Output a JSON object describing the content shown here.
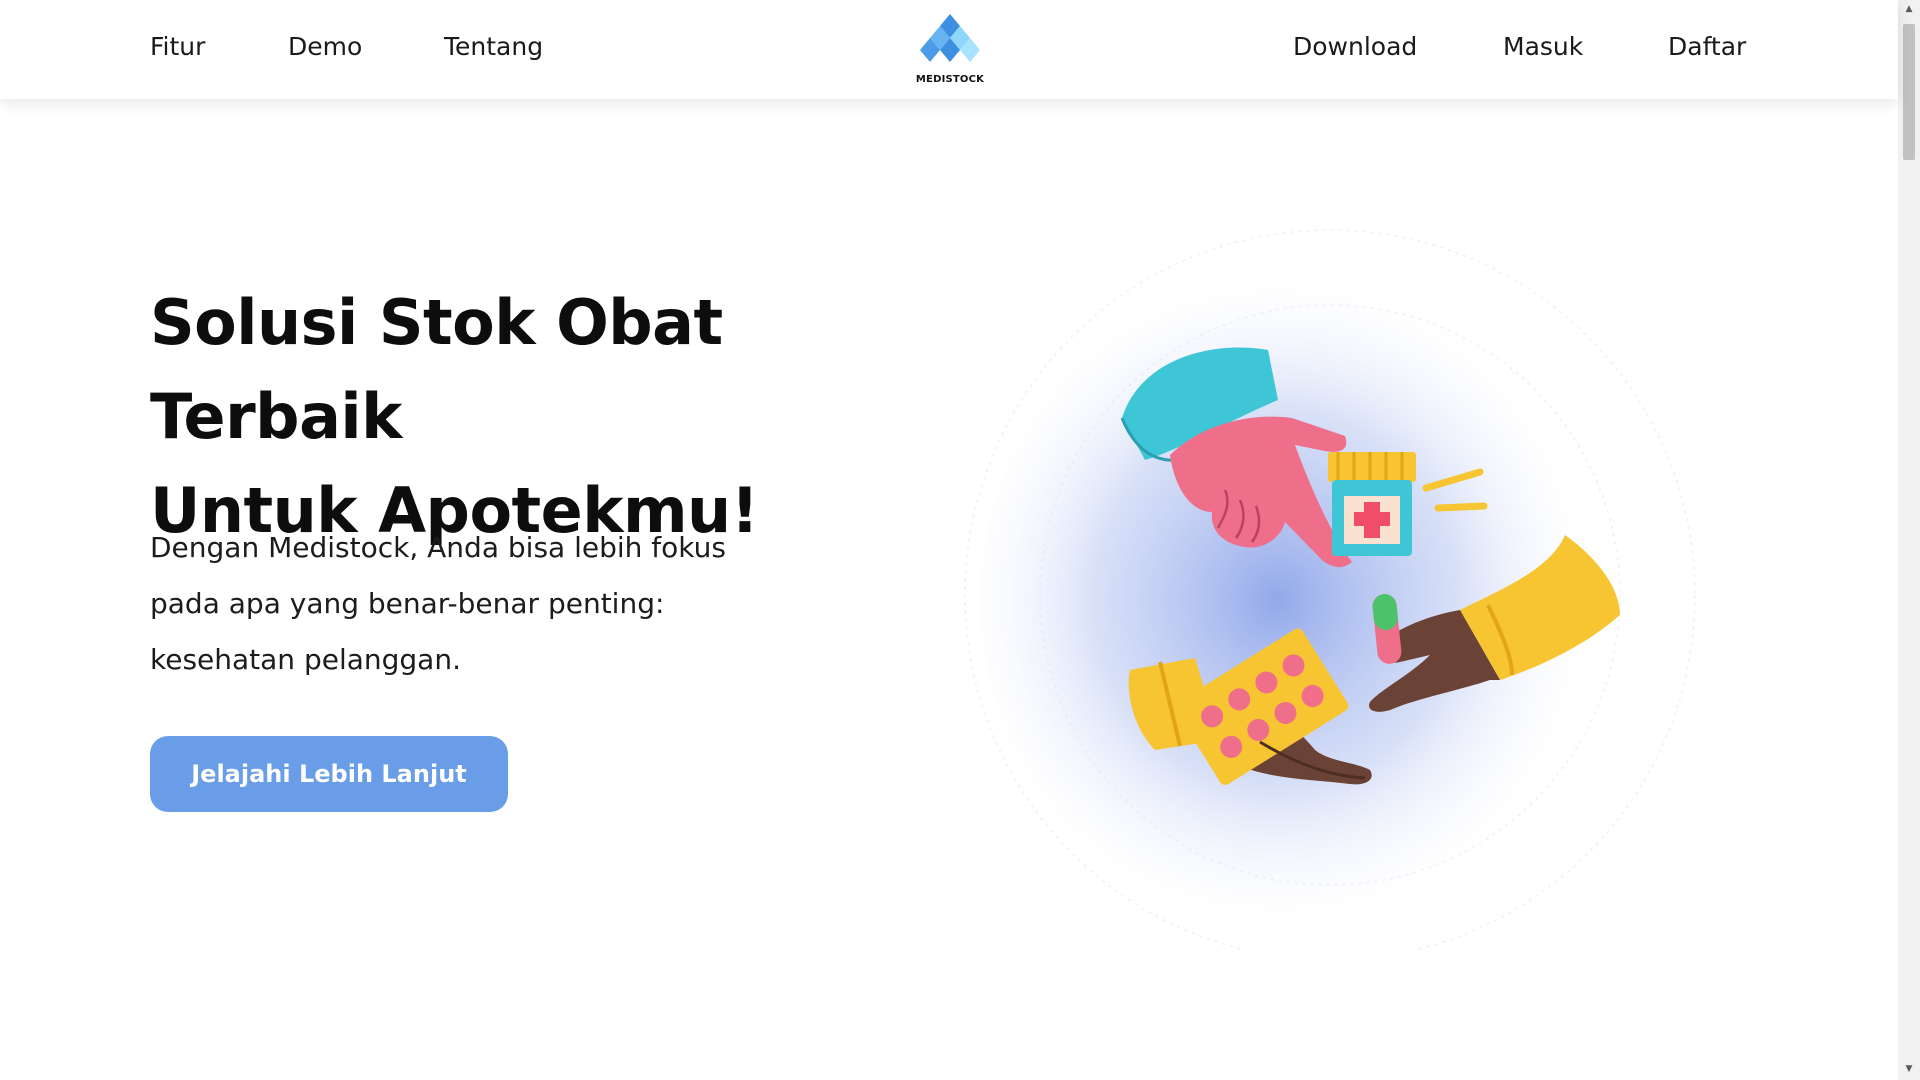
{
  "nav": {
    "left": [
      "Fitur",
      "Demo",
      "Tentang"
    ],
    "right": [
      "Download",
      "Masuk",
      "Daftar"
    ],
    "logo_text": "MEDISTOCK"
  },
  "hero": {
    "title_line1": "Solusi Stok Obat Terbaik",
    "title_line2": "Untuk Apotekmu!",
    "sub_line1": "Dengan Medistock, Anda bisa lebih fokus",
    "sub_line2": "pada apa yang benar-benar penting:",
    "sub_line3": "kesehatan pelanggan.",
    "cta_label": "Jelajahi Lebih Lanjut"
  },
  "colors": {
    "accent": "#6a9de8",
    "teal": "#3fc6d6",
    "pink": "#ef6f8b",
    "yellow": "#f7c531",
    "skin_dark": "#6b4236"
  },
  "icons": {
    "logo": "medistock-cubes-logo",
    "illustration": "hands-exchanging-medicine"
  }
}
